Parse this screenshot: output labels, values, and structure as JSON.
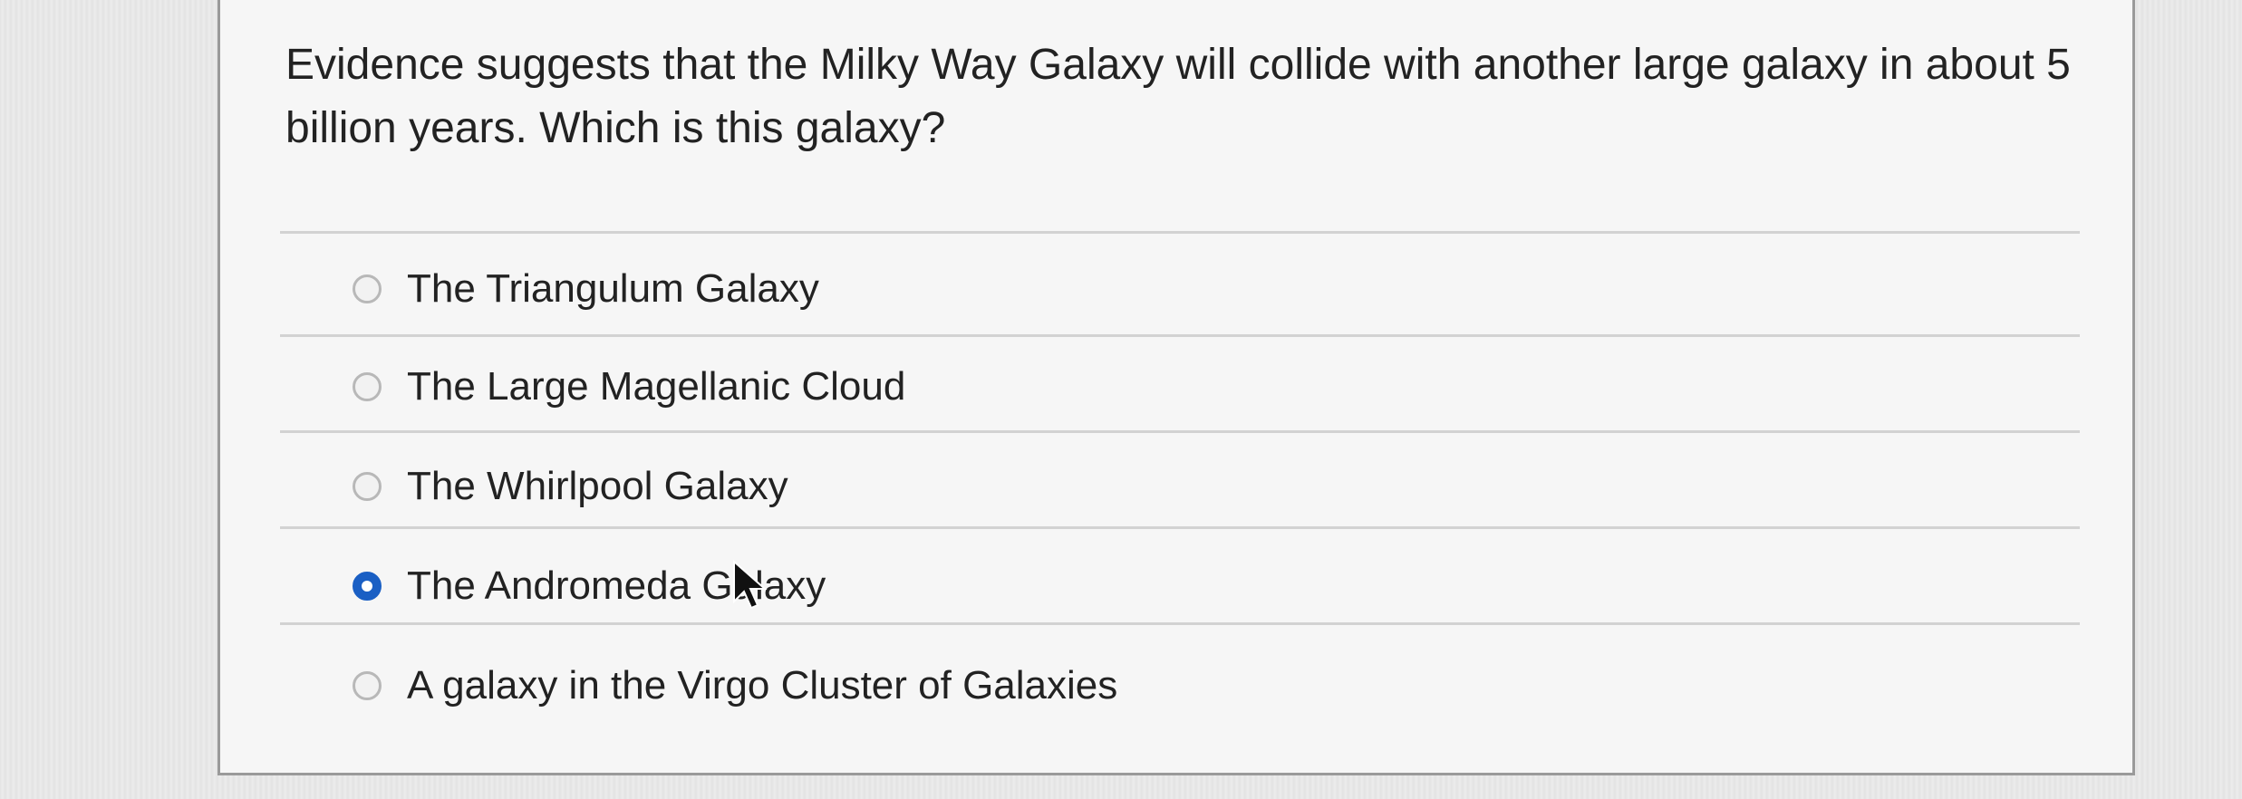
{
  "question": {
    "text": "Evidence suggests that the Milky Way Galaxy will collide with another large galaxy in about 5 billion years.  Which is this galaxy?"
  },
  "answers": [
    {
      "label": "The Triangulum Galaxy",
      "selected": false
    },
    {
      "label": "The Large Magellanic Cloud",
      "selected": false
    },
    {
      "label": "The Whirlpool Galaxy",
      "selected": false
    },
    {
      "label": "The Andromeda Galaxy",
      "selected": true
    },
    {
      "label": "A galaxy in the Virgo Cluster of Galaxies",
      "selected": false
    }
  ],
  "colors": {
    "selected_radio": "#1a5fc4",
    "text": "#222222",
    "divider": "#d2d2d2"
  },
  "icons": {
    "cursor": "mouse-pointer-icon"
  }
}
